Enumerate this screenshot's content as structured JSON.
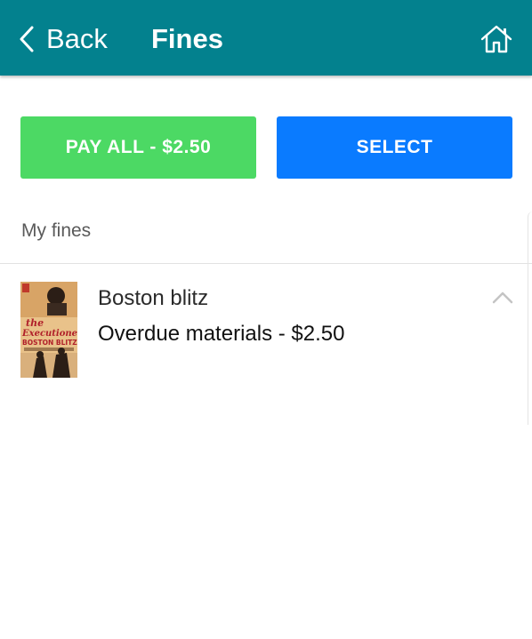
{
  "header": {
    "back_label": "Back",
    "title": "Fines",
    "background": "#03818e"
  },
  "actions": {
    "pay_all_label": "PAY ALL - $2.50",
    "pay_all_color": "#4cd964",
    "select_label": "SELECT",
    "select_color": "#0a7bff"
  },
  "section": {
    "label": "My fines"
  },
  "fines": [
    {
      "title": "Boston blitz",
      "description": "Overdue materials - $2.50",
      "cover_icon": "book-cover",
      "cover_text": [
        "the",
        "Executioner",
        "BOSTON BLITZ"
      ],
      "expanded": true
    }
  ],
  "icons": {
    "back": "chevron-left-icon",
    "home": "home-icon",
    "collapse": "chevron-up-icon"
  }
}
